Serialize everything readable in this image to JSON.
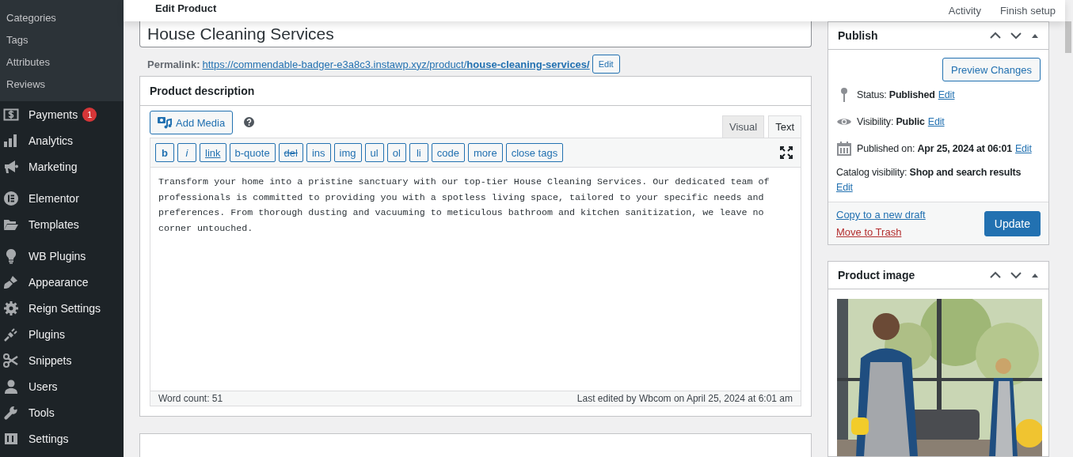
{
  "sidebar": {
    "submenu": [
      {
        "label": "Categories"
      },
      {
        "label": "Tags"
      },
      {
        "label": "Attributes"
      },
      {
        "label": "Reviews"
      }
    ],
    "groups": [
      {
        "items": [
          {
            "label": "Payments",
            "badge": "1"
          },
          {
            "label": "Analytics"
          },
          {
            "label": "Marketing"
          }
        ]
      },
      {
        "items": [
          {
            "label": "Elementor"
          },
          {
            "label": "Templates"
          }
        ]
      },
      {
        "items": [
          {
            "label": "WB Plugins"
          },
          {
            "label": "Appearance"
          },
          {
            "label": "Reign Settings"
          },
          {
            "label": "Plugins"
          },
          {
            "label": "Snippets"
          },
          {
            "label": "Users"
          },
          {
            "label": "Tools"
          },
          {
            "label": "Settings"
          }
        ]
      }
    ]
  },
  "header": {
    "title": "Edit Product",
    "links": [
      "Activity",
      "Finish setup"
    ]
  },
  "product_title": "House Cleaning Services",
  "permalink": {
    "label": "Permalink:",
    "url": "https://commendable-badger-e3a8c3.instawp.xyz/product/**house-cleaning-services/**",
    "edit": "Edit"
  },
  "description": {
    "title": "Product description",
    "add_media": "Add Media",
    "tabs": [
      {
        "label": "Visual",
        "selected": false
      },
      {
        "label": "Text",
        "selected": true
      }
    ],
    "quicktags": [
      {
        "label": "b",
        "kind": "bold"
      },
      {
        "label": "i",
        "kind": "italic"
      },
      {
        "label": "link",
        "kind": "underline"
      },
      {
        "label": "b-quote",
        "kind": "plain"
      },
      {
        "label": "del",
        "kind": "strike"
      },
      {
        "label": "ins",
        "kind": "plain"
      },
      {
        "label": "img",
        "kind": "plain"
      },
      {
        "label": "ul",
        "kind": "plain"
      },
      {
        "label": "ol",
        "kind": "plain"
      },
      {
        "label": "li",
        "kind": "plain"
      },
      {
        "label": "code",
        "kind": "plain"
      },
      {
        "label": "more",
        "kind": "plain"
      },
      {
        "label": "close tags",
        "kind": "plain"
      }
    ],
    "content": "Transform your home into a pristine sanctuary with our top-tier House Cleaning Services. Our dedicated team of professionals is committed to providing you with a spotless living space, tailored to your specific needs and preferences. From thorough dusting and vacuuming to meticulous bathroom and kitchen sanitization, we leave no corner untouched.",
    "word_count": "Word count: 51",
    "last_edited": "Last edited by Wbcom on April 25, 2024 at 6:01 am"
  },
  "publish": {
    "title": "Publish",
    "preview": "Preview Changes",
    "rows": [
      {
        "kind": "status",
        "text": "Status: **Published**",
        "edit": "Edit"
      },
      {
        "kind": "visibility",
        "text": "Visibility: **Public**",
        "edit": "Edit"
      },
      {
        "kind": "date",
        "text": "Published on: **Apr 25, 2024 at 06:01**",
        "edit": "Edit"
      },
      {
        "kind": "catalog",
        "text": "Catalog visibility: **Shop and search results**",
        "edit": "Edit"
      }
    ],
    "copy": "Copy to a new draft",
    "trash": "Move to Trash",
    "update": "Update"
  },
  "product_image": {
    "title": "Product image"
  }
}
